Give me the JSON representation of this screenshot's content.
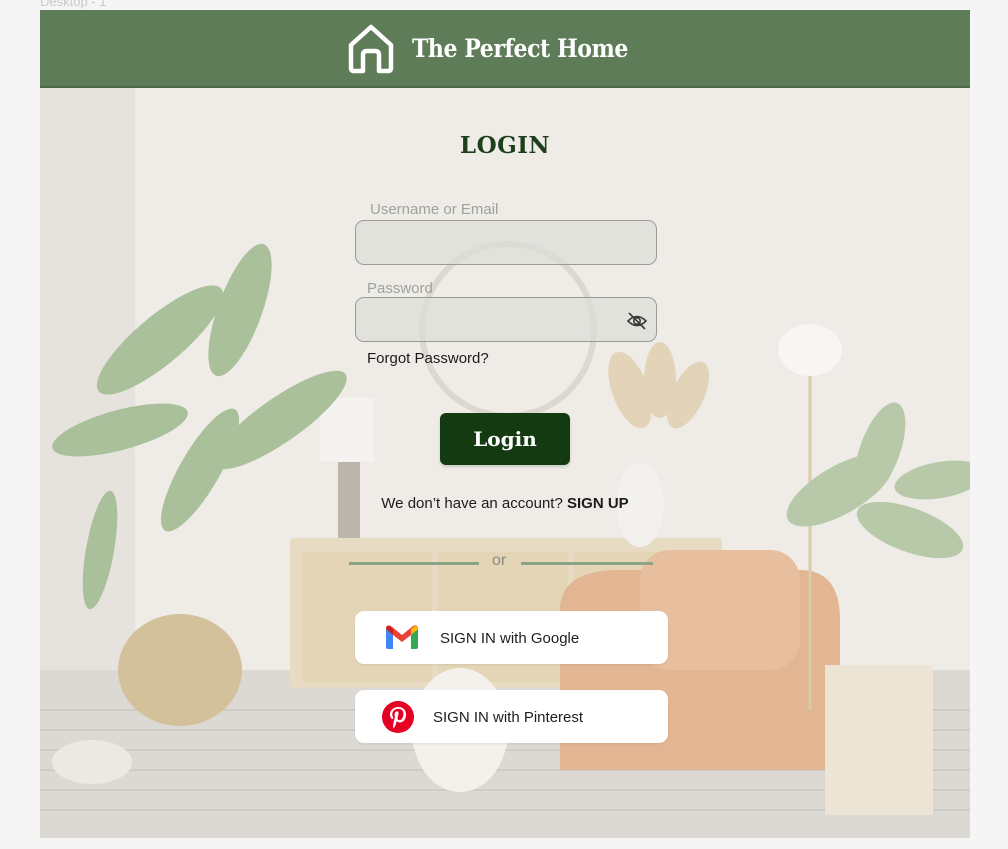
{
  "frame_label": "Desktop - 1",
  "header": {
    "brand_name": "The Perfect Home",
    "logo_icon": "house-outline-icon",
    "background": "#5e7c58"
  },
  "form": {
    "title": "LOGIN",
    "username_label": "Username or Email",
    "username_value": "",
    "password_label": "Password",
    "password_value": "",
    "password_toggle_icon": "eye-off-icon",
    "forgot_link": "Forgot Password?",
    "login_button": "Login",
    "signup_prompt": "We don’t have an account?",
    "signup_link": "SIGN UP",
    "divider_text": "or"
  },
  "social": {
    "google": {
      "label": "SIGN IN with Google",
      "icon": "gmail-icon"
    },
    "pinterest": {
      "label": "SIGN IN with Pinterest",
      "icon": "pinterest-icon"
    }
  },
  "colors": {
    "accent_dark": "#143a12",
    "title": "#1e3f1c",
    "divider": "#8aa487"
  }
}
